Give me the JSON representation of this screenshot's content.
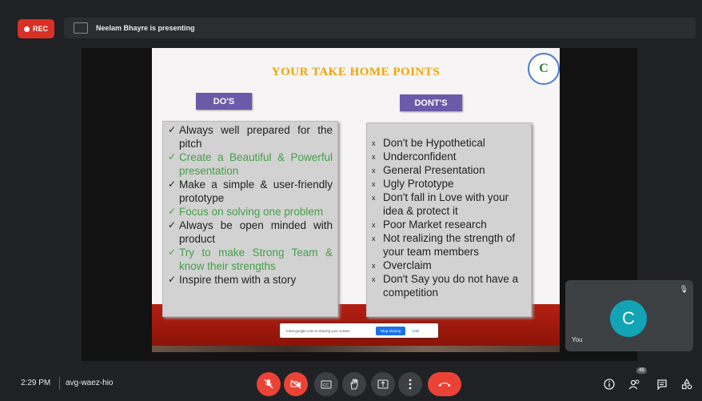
{
  "top": {
    "rec_label": "REC",
    "presenting_text": "Neelam Bhayre is presenting"
  },
  "slide": {
    "title": "YOUR TAKE HOME POINTS",
    "logo_letter": "C",
    "dos_header": "DO'S",
    "donts_header": "DONT'S",
    "dos": [
      {
        "text": "Always well prepared for the pitch",
        "green": false
      },
      {
        "text": "Create a Beautiful & Powerful presentation",
        "green": true
      },
      {
        "text": "Make a simple & user-friendly prototype",
        "green": false
      },
      {
        "text": "Focus on solving one problem",
        "green": true
      },
      {
        "text": "Always be open minded with product",
        "green": false
      },
      {
        "text": "Try to make Strong Team & know their strengths",
        "green": true
      },
      {
        "text": "Inspire them with a story",
        "green": false
      }
    ],
    "dos_mark": "✓",
    "donts_mark": "x",
    "donts": [
      "Don't be Hypothetical",
      "Underconfident",
      "General Presentation",
      "Ugly Prototype",
      "Don't fall in Love with your idea & protect it",
      "Poor Market research",
      "Not realizing the strength of your team members",
      "Overclaim",
      "Don't Say you do not have a competition"
    ]
  },
  "share_bar": {
    "message": "meet.google.com is sharing your screen",
    "stop_label": "Stop sharing",
    "hide_label": "Hide"
  },
  "self_tile": {
    "initial": "C",
    "label": "You"
  },
  "bottom": {
    "time": "2:29 PM",
    "meeting_code": "avg-waez-hio",
    "participant_count": "48"
  },
  "colors": {
    "title": "#f0a500",
    "header_bg": "#6a5aa8",
    "green_text": "#43a047",
    "rec": "#d93025",
    "avatar": "#12a4b5"
  }
}
